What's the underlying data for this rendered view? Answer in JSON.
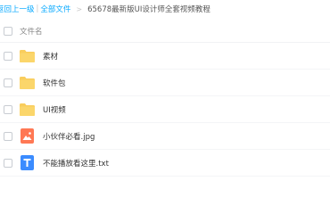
{
  "breadcrumb": {
    "back": "返回上一级",
    "separator": "|",
    "all_files": "全部文件",
    "arrow": ">",
    "current": "65678最新版UI设计师全套视频教程"
  },
  "header": {
    "column_label": "文件名"
  },
  "files": [
    {
      "name": "素材",
      "icon": "folder-icon"
    },
    {
      "name": "软件包",
      "icon": "folder-icon"
    },
    {
      "name": "UI视频",
      "icon": "folder-icon"
    },
    {
      "name": "小伙伴必看.jpg",
      "icon": "image-file-icon"
    },
    {
      "name": "不能播放看这里.txt",
      "icon": "text-file-icon"
    }
  ],
  "colors": {
    "link": "#09aaff",
    "folder": "#f9cd5d",
    "image_file": "#ff7854",
    "text_file": "#3b8cff"
  }
}
